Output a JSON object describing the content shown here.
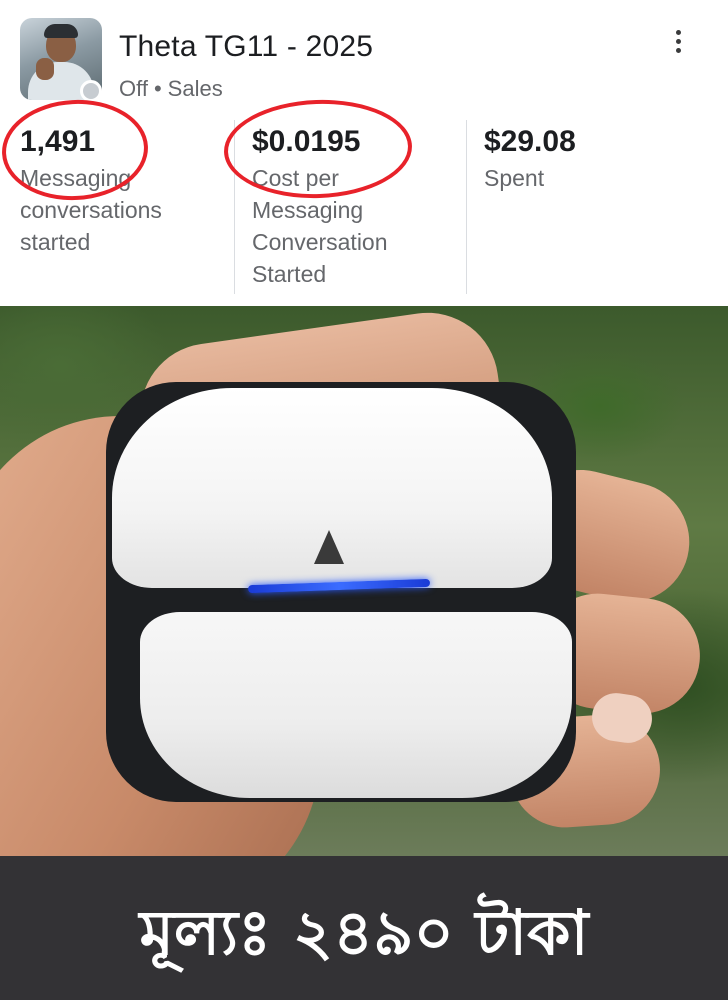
{
  "ad": {
    "title": "Theta TG11 - 2025",
    "status": "Off",
    "separator": "•",
    "objective": "Sales",
    "metrics": [
      {
        "value": "1,491",
        "label": "Messaging\nconversations\nstarted"
      },
      {
        "value": "$0.0195",
        "label": "Cost per\nMessaging\nConversation\nStarted"
      },
      {
        "value": "$29.08",
        "label": "Spent"
      }
    ]
  },
  "icons": {
    "more": "more-vertical-icon",
    "status_indicator": "status-dot-icon"
  },
  "colors": {
    "highlight_ring": "#e8222a",
    "banner_bg": "#333235",
    "led": "#2a5bff"
  },
  "banner": {
    "price_text": "মূল্যঃ ২৪৯০ টাকা"
  }
}
